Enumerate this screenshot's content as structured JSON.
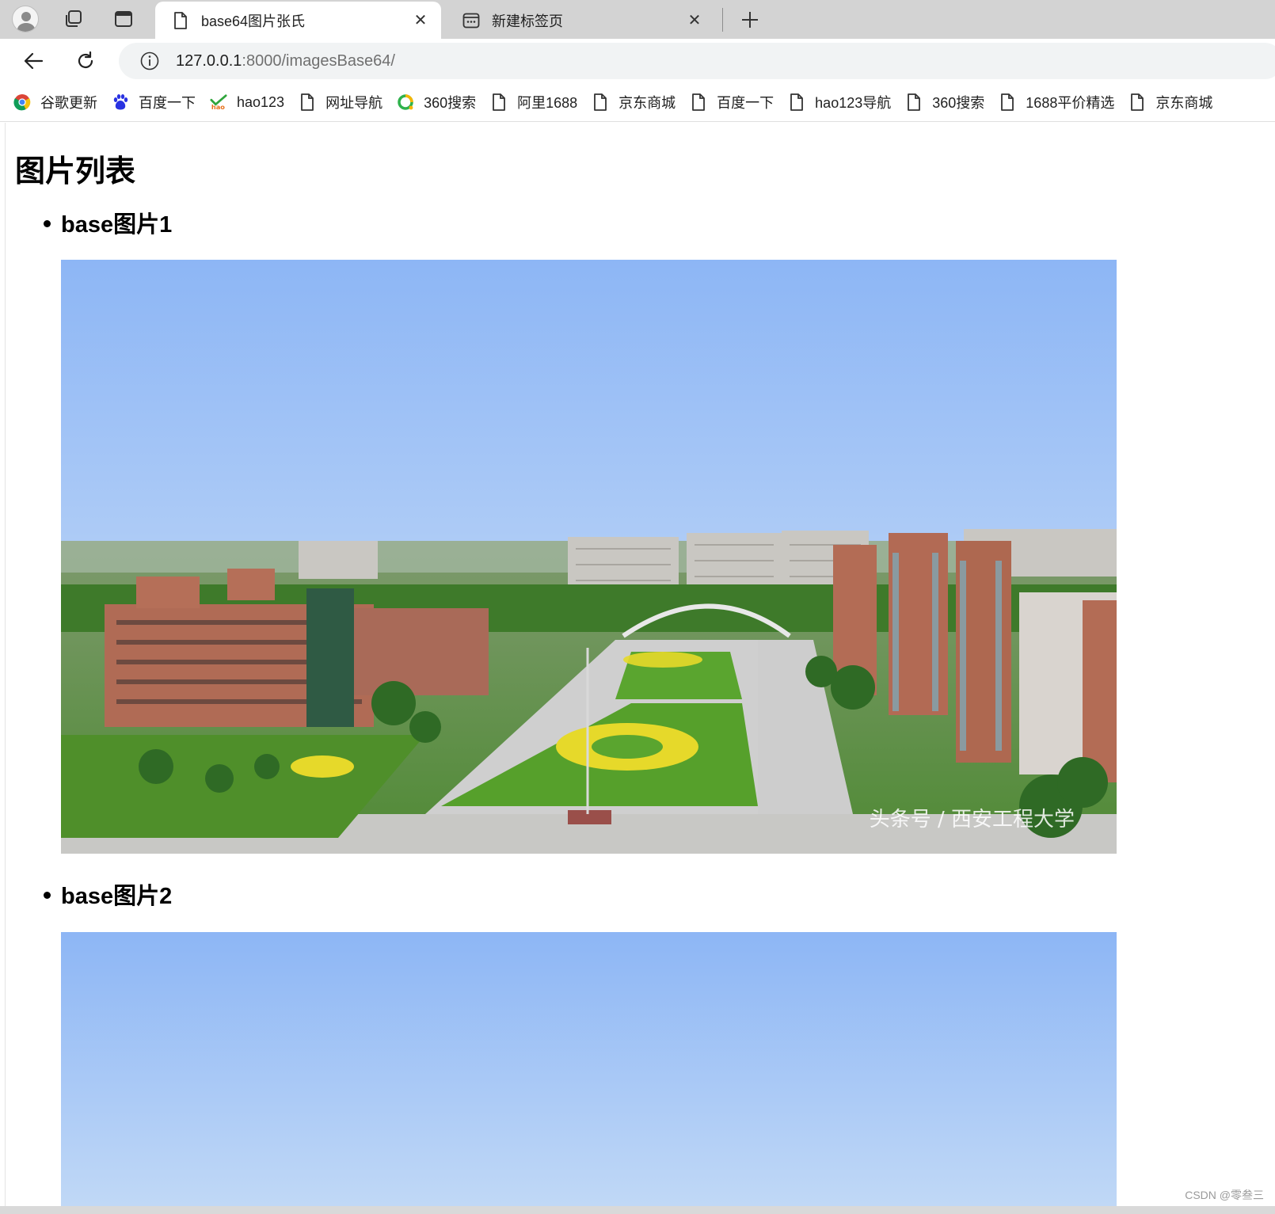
{
  "browser": {
    "tabs": [
      {
        "title": "base64图片张氏",
        "active": true
      },
      {
        "title": "新建标签页",
        "active": false
      }
    ],
    "address": {
      "host": "127.0.0.1",
      "path": ":8000/imagesBase64/"
    },
    "bookmarks": [
      {
        "label": "谷歌更新",
        "icon": "chrome-icon"
      },
      {
        "label": "百度一下",
        "icon": "baidu-paw-icon"
      },
      {
        "label": "hao123",
        "icon": "hao123-icon"
      },
      {
        "label": "网址导航",
        "icon": "page-icon"
      },
      {
        "label": "360搜索",
        "icon": "360-icon"
      },
      {
        "label": "阿里1688",
        "icon": "page-icon"
      },
      {
        "label": "京东商城",
        "icon": "page-icon"
      },
      {
        "label": "百度一下",
        "icon": "page-icon"
      },
      {
        "label": "hao123导航",
        "icon": "page-icon"
      },
      {
        "label": "360搜索",
        "icon": "page-icon"
      },
      {
        "label": "1688平价精选",
        "icon": "page-icon"
      },
      {
        "label": "京东商城",
        "icon": "page-icon"
      }
    ]
  },
  "page": {
    "title": "图片列表",
    "items": [
      {
        "label": "base图片1",
        "image_caption": "头条号 / 西安工程大学"
      },
      {
        "label": "base图片2"
      }
    ]
  },
  "watermark": "CSDN @零叁三",
  "colors": {
    "tabstrip": "#d3d3d3",
    "address_bar": "#f1f3f4",
    "sky_top": "#8db6f5",
    "sky_bottom": "#c7dcf7",
    "lawn": "#4f9a2a",
    "brick": "#b06b55"
  }
}
